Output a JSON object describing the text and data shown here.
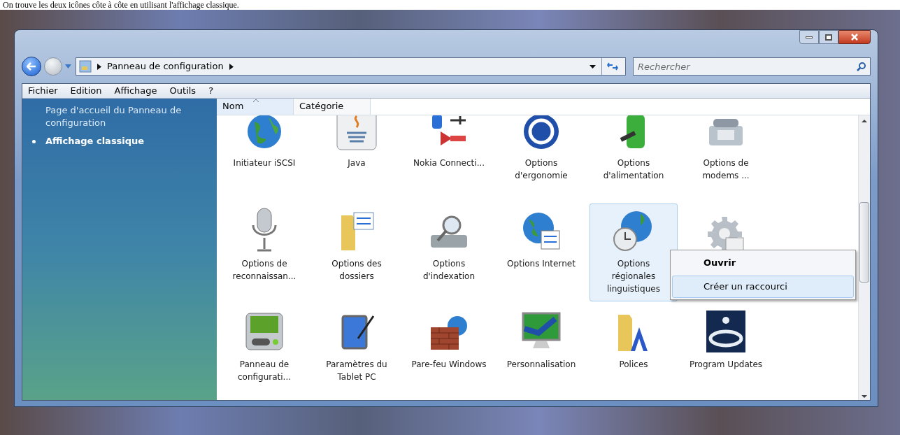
{
  "caption": "On trouve les deux icônes côte à côte en utilisant l'affichage classique.",
  "address": {
    "crumbs": [
      "Panneau de configuration"
    ]
  },
  "search": {
    "placeholder": "Rechercher"
  },
  "menu_bar": [
    "Fichier",
    "Edition",
    "Affichage",
    "Outils",
    "?"
  ],
  "sidebar": {
    "items": [
      {
        "label": "Page d'accueil du Panneau de configuration",
        "selected": false
      },
      {
        "label": "Affichage classique",
        "selected": true
      }
    ]
  },
  "columns": [
    {
      "label": "Nom",
      "sorted": true
    },
    {
      "label": "Catégorie",
      "sorted": false
    }
  ],
  "items": [
    {
      "label": "Initiateur iSCSI",
      "selected": false
    },
    {
      "label": "Java",
      "selected": false
    },
    {
      "label": "Nokia Connecti...",
      "selected": false
    },
    {
      "label": "Options d'ergonomie",
      "selected": false
    },
    {
      "label": "Options d'alimentation",
      "selected": false
    },
    {
      "label": "Options de modems ...",
      "selected": false
    },
    {
      "label": "Options de reconnaissan...",
      "selected": false
    },
    {
      "label": "Options des dossiers",
      "selected": false
    },
    {
      "label": "Options d'indexation",
      "selected": false
    },
    {
      "label": "Options Internet",
      "selected": false
    },
    {
      "label": "Options régionales linguistiques",
      "selected": true
    },
    {
      "selected": false
    },
    {
      "label": "Panneau de configurati...",
      "selected": false
    },
    {
      "label": "Paramètres du Tablet PC",
      "selected": false
    },
    {
      "label": "Pare-feu Windows",
      "selected": false
    },
    {
      "label": "Personnalisation",
      "selected": false
    },
    {
      "label": "Polices",
      "selected": false
    },
    {
      "label": "Program Updates",
      "selected": false
    }
  ],
  "context_menu": [
    {
      "label": "Ouvrir",
      "default": true,
      "highlighted": false
    },
    {
      "label": "Créer un raccourci",
      "default": false,
      "highlighted": true
    }
  ]
}
